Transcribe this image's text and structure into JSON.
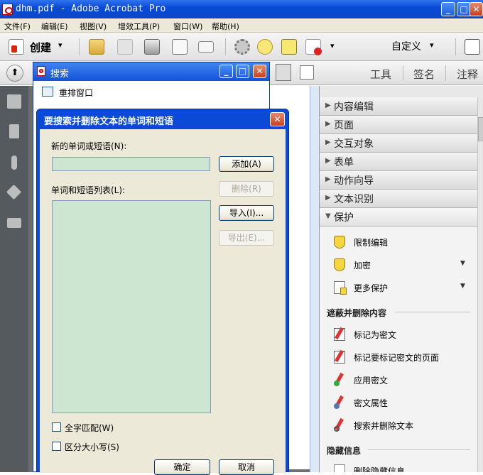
{
  "window": {
    "title": "dhm.pdf - Adobe Acrobat Pro",
    "min": "_",
    "max": "□",
    "close": "✕"
  },
  "menu": [
    "文件(F)",
    "编辑(E)",
    "视图(V)",
    "增效工具(P)",
    "窗口(W)",
    "帮助(H)"
  ],
  "toolbar": {
    "create_label": "创建",
    "create_arrow": "▾",
    "customize_label": "自定义",
    "customize_arrow": "▾",
    "more_arrow": "▾"
  },
  "tabs": {
    "tools": "工具",
    "sign": "签名",
    "comment": "注释"
  },
  "right_panel": {
    "sections": [
      "内容编辑",
      "页面",
      "交互对象",
      "表单",
      "动作向导",
      "文本识别"
    ],
    "open_section": "保护",
    "protect_items": [
      {
        "label": "限制编辑",
        "icon": "shield-icon",
        "dropdown": false
      },
      {
        "label": "加密",
        "icon": "shield-icon",
        "dropdown": true
      },
      {
        "label": "更多保护",
        "icon": "shield-doc-icon",
        "dropdown": true
      }
    ],
    "redact_header": "遮蔽并删除内容",
    "redact_items": [
      {
        "label": "标记为密文",
        "icon": "pen-redact-icon"
      },
      {
        "label": "标记要标记密文的页面",
        "icon": "pen-redact-icon"
      },
      {
        "label": "应用密文",
        "icon": "pen-apply-icon"
      },
      {
        "label": "密文属性",
        "icon": "pen-properties-icon"
      },
      {
        "label": "搜索并删除文本",
        "icon": "pen-search-icon"
      }
    ],
    "hidden_header": "隐藏信息",
    "hidden_items": [
      {
        "label": "删除隐藏信息",
        "icon": "doc-icon"
      }
    ]
  },
  "search_window": {
    "title": "搜索",
    "arrange_label": "重排窗口"
  },
  "dialog": {
    "title": "要搜索并删除文本的单词和短语",
    "new_word_label": "新的单词或短语(N):",
    "new_word_value": "",
    "add_button": "添加(A)",
    "list_label": "单词和短语列表(L):",
    "remove_button": "删除(R)",
    "import_button": "导入(I)...",
    "export_button": "导出(E)...",
    "whole_word_label": "全字匹配(W)",
    "case_label": "区分大小写(S)",
    "ok_button": "确定",
    "cancel_button": "取消",
    "close": "✕"
  },
  "colors": {
    "accent": "#0a4ad6",
    "input_fill": "#cce6d2",
    "panel_bg": "#f3f3f3"
  }
}
